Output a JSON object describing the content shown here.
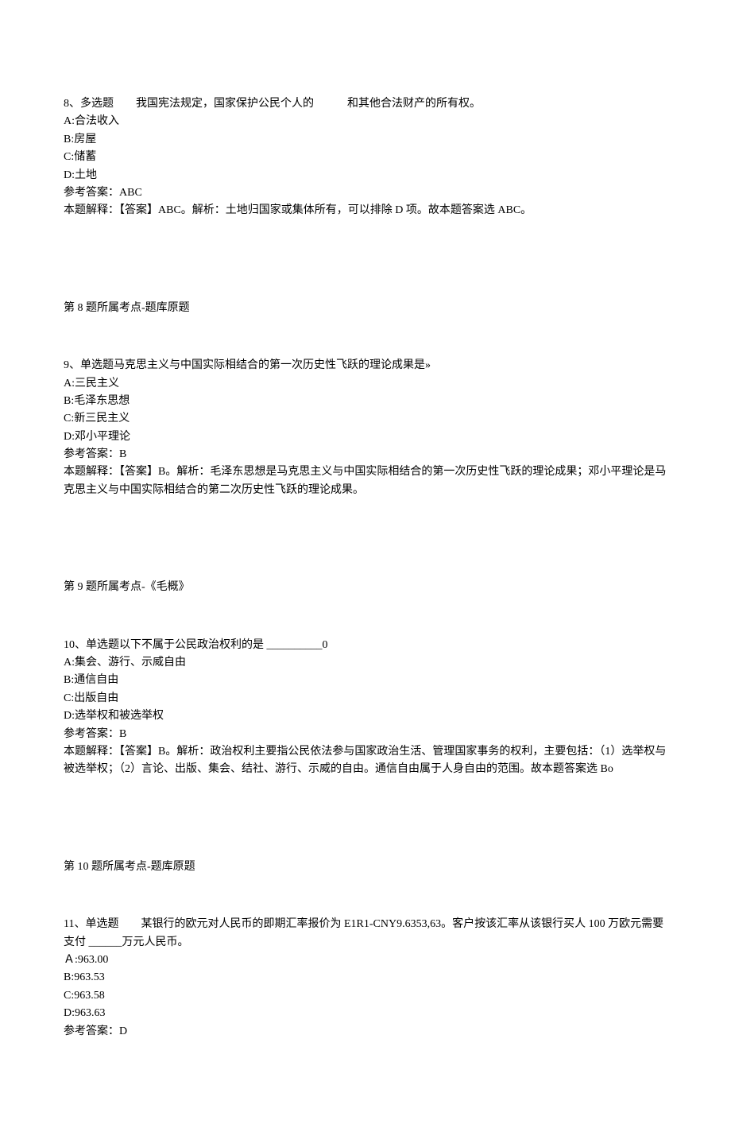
{
  "q8": {
    "title": "8、多选题　　我国宪法规定，国家保护公民个人的　　　和其他合法财产的所有权。",
    "optA": "A:合法收入",
    "optB": "B:房屋",
    "optC": "C:储蓄",
    "optD": "D:土地",
    "answerLabel": "参考答案：ABC",
    "explain": "本题解释：【答案】ABC。解析：土地归国家或集体所有，可以排除 D 项。故本题答案选 ABC。",
    "topic": "第 8 题所属考点-题库原题"
  },
  "q9": {
    "title": "9、单选题马克思主义与中国实际相结合的第一次历史性飞跃的理论成果是»",
    "optA": "A:三民主义",
    "optB": "B:毛泽东思想",
    "optC": "C:新三民主义",
    "optD": "D:邓小平理论",
    "answerLabel": "参考答案：B",
    "explain": "本题解释：【答案】B。解析：毛泽东思想是马克思主义与中国实际相结合的第一次历史性飞跃的理论成果；邓小平理论是马克思主义与中国实际相结合的第二次历史性飞跃的理论成果。",
    "topic": "第 9 题所属考点-《毛概》"
  },
  "q10": {
    "title": "10、单选题以下不属于公民政治权利的是 __________0",
    "optA": "A:集会、游行、示威自由",
    "optB": "B:通信自由",
    "optC": "C:出版自由",
    "optD": "D:选举权和被选举权",
    "answerLabel": "参考答案：B",
    "explain": "本题解释：【答案】B。解析：政治权利主要指公民依法参与国家政治生活、管理国家事务的权利，主要包括：（1）选举权与被选举权；（2）言论、出版、集会、结社、游行、示威的自由。通信自由属于人身自由的范围。故本题答案选 Bo",
    "topic": "第 10 题所属考点-题库原题"
  },
  "q11": {
    "title": "11、单选题　　某银行的欧元对人民币的即期汇率报价为 E1R1-CNY9.6353,63。客户按该汇率从该银行买人 100 万欧元需要支付 ______万元人民币。",
    "optA": "Ａ:963.00",
    "optB": "B:963.53",
    "optC": "C:963.58",
    "optD": "D:963.63",
    "answerLabel": "参考答案：D"
  }
}
